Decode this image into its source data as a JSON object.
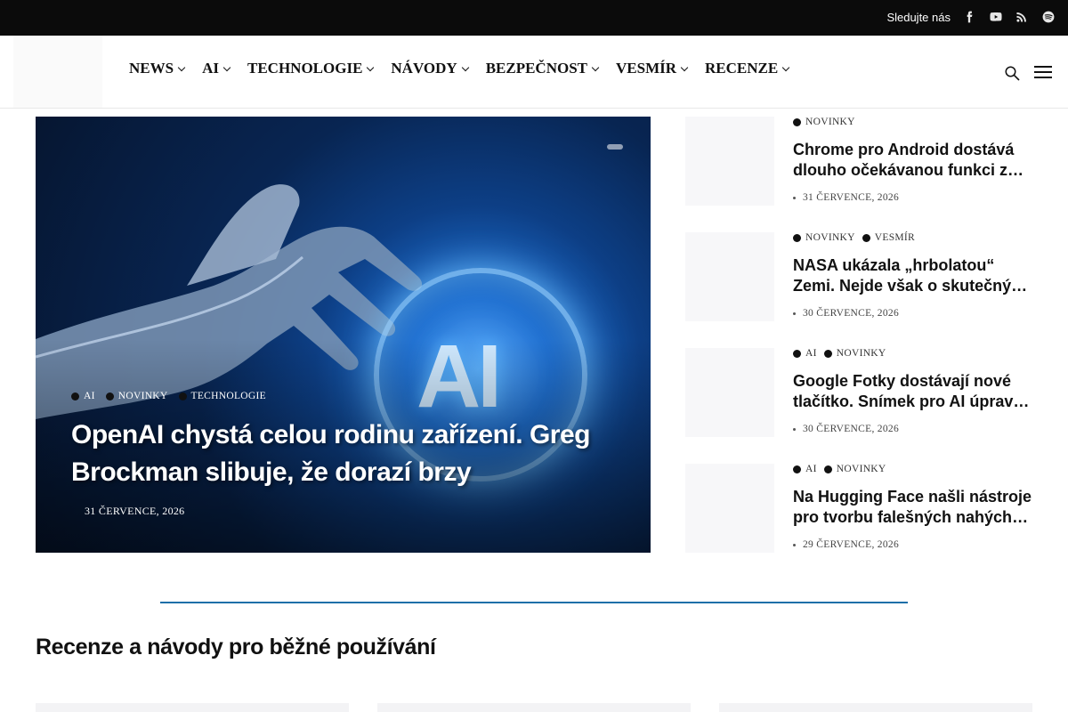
{
  "topbar": {
    "follow_label": "Sledujte nás",
    "social": [
      {
        "name": "facebook-icon"
      },
      {
        "name": "youtube-icon"
      },
      {
        "name": "rss-icon"
      },
      {
        "name": "spotify-icon"
      }
    ]
  },
  "nav": {
    "items": [
      {
        "label": "NEWS"
      },
      {
        "label": "AI"
      },
      {
        "label": "TECHNOLOGIE"
      },
      {
        "label": "NÁVODY"
      },
      {
        "label": "BEZPEČNOST"
      },
      {
        "label": "VESMÍR"
      },
      {
        "label": "RECENZE"
      }
    ]
  },
  "hero": {
    "categories": [
      "AI",
      "NOVINKY",
      "TECHNOLOGIE"
    ],
    "title": "OpenAI chystá celou rodinu zařízení. Greg Brockman slibuje, že dorazí brzy",
    "date": "31 ČERVENCE, 2026",
    "image_text": "AI"
  },
  "side": [
    {
      "categories": [
        "NOVINKY"
      ],
      "title": "Chrome pro Android dostává dlouho očekávanou funkci z desktopu",
      "date": "31 ČERVENCE, 2026"
    },
    {
      "categories": [
        "NOVINKY",
        "VESMÍR"
      ],
      "title": "NASA ukázala „hrbolatou“ Zemi. Nejde však o skutečný tvar planety",
      "date": "30 ČERVENCE, 2026"
    },
    {
      "categories": [
        "AI",
        "NOVINKY"
      ],
      "title": "Google Fotky dostávají nové tlačítko. Snímek pro AI úpravy označí",
      "date": "30 ČERVENCE, 2026"
    },
    {
      "categories": [
        "AI",
        "NOVINKY"
      ],
      "title": "Na Hugging Face našli nástroje pro tvorbu falešných nahých fotografií",
      "date": "29 ČERVENCE, 2026"
    }
  ],
  "section": {
    "title": "Recenze a návody pro běžné používání"
  }
}
